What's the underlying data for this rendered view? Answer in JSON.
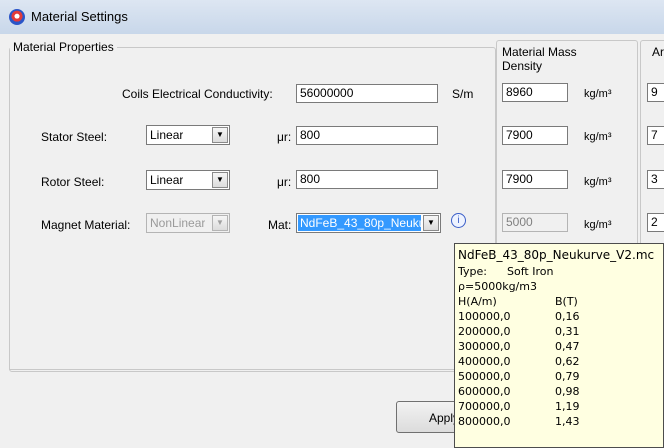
{
  "window": {
    "title": "Material Settings"
  },
  "material_properties": {
    "legend": "Material Properties",
    "coils_conductivity": {
      "label": "Coils Electrical Conductivity:",
      "value": "56000000",
      "unit": "S/m"
    },
    "stator": {
      "label": "Stator Steel:",
      "type": "Linear",
      "mu_label": "μr:",
      "mu_value": "800"
    },
    "rotor": {
      "label": "Rotor Steel:",
      "type": "Linear",
      "mu_label": "μr:",
      "mu_value": "800"
    },
    "magnet": {
      "label": "Magnet Material:",
      "type": "NonLinear",
      "mat_label": "Mat:",
      "mat_value": "NdFeB_43_80p_Neukurve_V2.mc"
    }
  },
  "mass_density": {
    "legend": "Material Mass Density",
    "legend_line1": "Material Mass",
    "legend_line2": "Density",
    "rows": [
      {
        "value": "8960",
        "unit": "kg/m³"
      },
      {
        "value": "7900",
        "unit": "kg/m³"
      },
      {
        "value": "7900",
        "unit": "kg/m³"
      },
      {
        "value": "5000",
        "unit": "kg/m³"
      }
    ]
  },
  "third_group": {
    "legend_fragment": "Ar",
    "values": [
      "9",
      "7",
      "3",
      "2"
    ]
  },
  "tooltip": {
    "filename": "NdFeB_43_80p_Neukurve_V2.mc",
    "type_label": "Type:",
    "type_value": "Soft Iron",
    "density": "ρ=5000kg/m3",
    "col_h": "H(A/m)",
    "col_b": "B(T)",
    "rows": [
      {
        "h": "100000,0",
        "b": "0,16"
      },
      {
        "h": "200000,0",
        "b": "0,31"
      },
      {
        "h": "300000,0",
        "b": "0,47"
      },
      {
        "h": "400000,0",
        "b": "0,62"
      },
      {
        "h": "500000,0",
        "b": "0,79"
      },
      {
        "h": "600000,0",
        "b": "0,98"
      },
      {
        "h": "700000,0",
        "b": "1,19"
      },
      {
        "h": "800000,0",
        "b": "1,43"
      }
    ]
  },
  "apply_button": {
    "label": "Apply"
  }
}
